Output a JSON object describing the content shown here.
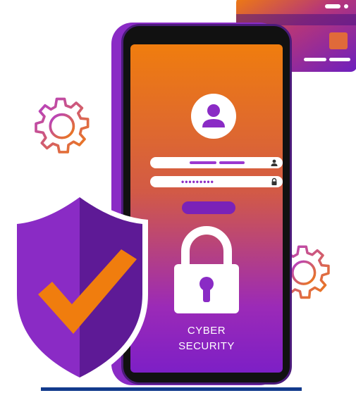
{
  "illustration": {
    "screen_text": {
      "line1": "CYBER",
      "line2": "SECURITY"
    },
    "password_mask": "•••••••••",
    "icons": [
      "credit-card-icon",
      "gear-icon",
      "user-avatar-icon",
      "user-field-icon",
      "padlock-field-icon",
      "padlock-icon",
      "shield-check-icon"
    ],
    "colors": {
      "orange": "#f07d0e",
      "purple": "#8a2bc5",
      "dark_purple": "#5e1a96",
      "navy": "#123a8c",
      "white": "#ffffff"
    }
  }
}
